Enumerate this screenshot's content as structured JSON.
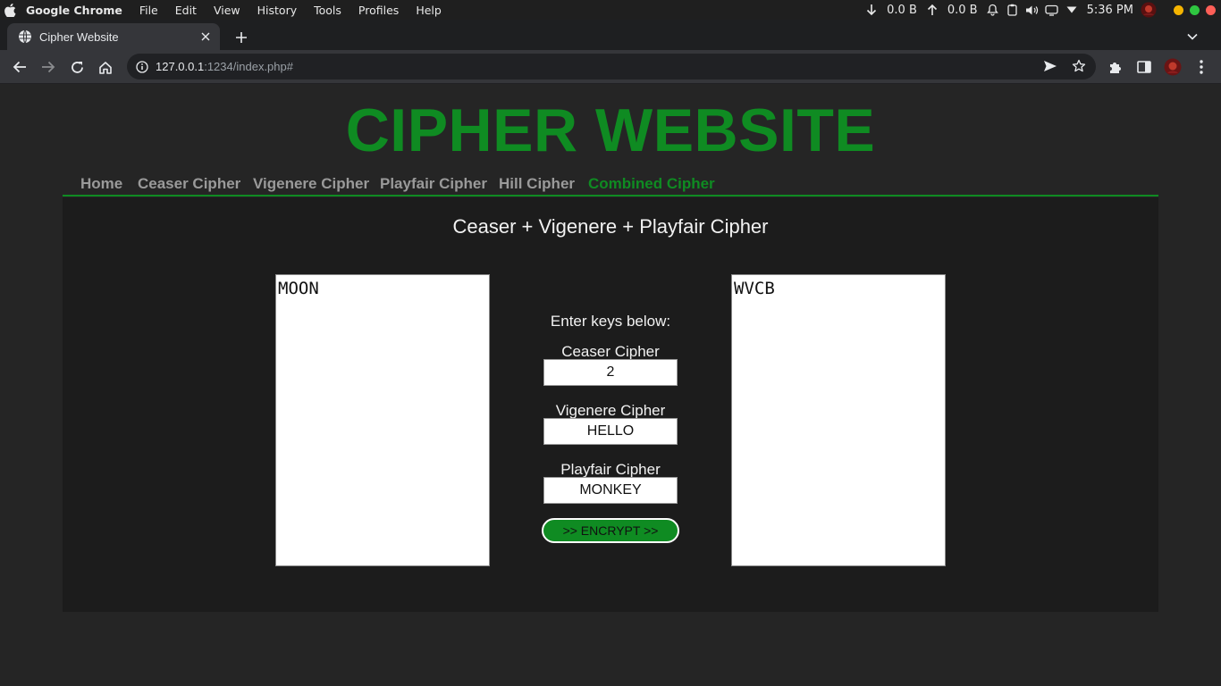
{
  "menubar": {
    "app_name": "Google Chrome",
    "items": [
      "File",
      "Edit",
      "View",
      "History",
      "Tools",
      "Profiles",
      "Help"
    ],
    "net_down": "0.0 B",
    "net_up": "0.0 B",
    "clock": "5:36 PM"
  },
  "browser": {
    "tab_title": "Cipher Website",
    "url_host": "127.0.0.1",
    "url_path": ":1234/index.php#"
  },
  "site": {
    "title": "CIPHER WEBSITE",
    "nav": [
      "Home",
      "Ceaser Cipher",
      "Vigenere Cipher",
      "Playfair Cipher",
      "Hill Cipher",
      "Combined Cipher"
    ],
    "active_nav": "Combined Cipher"
  },
  "panel": {
    "title": "Ceaser + Vigenere + Playfair Cipher",
    "input_text": "MOON",
    "output_text": "WVCB",
    "keys_label": "Enter keys below:",
    "ceaser_label": "Ceaser Cipher",
    "ceaser_key": "2",
    "vigenere_label": "Vigenere Cipher",
    "vigenere_key": "HELLO",
    "playfair_label": "Playfair Cipher",
    "playfair_key": "MONKEY",
    "encrypt_label": ">> ENCRYPT >>"
  },
  "colors": {
    "accent": "#0f8b22",
    "page_bg": "#252525",
    "panel_bg": "#1c1c1c"
  }
}
